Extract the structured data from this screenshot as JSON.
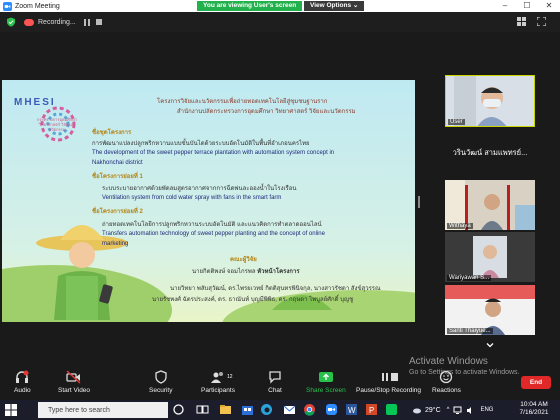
{
  "window": {
    "title": "Zoom Meeting",
    "min": "–",
    "max": "☐",
    "close": "✕"
  },
  "recording": {
    "label": "Recording..."
  },
  "share_banner": {
    "viewing": "You are viewing User's screen",
    "view_options": "View Options ⌄"
  },
  "slide": {
    "logo": "MHESI",
    "logo_sub": "กระทรวงการอุดมศึกษา วิทยาศาสตร์ วิจัยและนวัตกรรม",
    "header1": "โครงการวิจัยและนวัตกรรมเพื่อถ่ายทอดเทคโนโลยีสู่ชุมชนฐานราก",
    "header2": "สำนักงานปลัดกระทรวงการอุดมศึกษา วิทยาศาสตร์ วิจัยและนวัตกรรม",
    "project_label": "ชื่อชุดโครงการ",
    "project_th": "การพัฒนาแปลงปลูกพริกหวานแบบขั้นบันไดด้วยระบบอัตโนมัติในพื้นที่อำเภอนครไทย",
    "project_en1": "The development of the sweet pepper terrace plantation with automation  system concept in",
    "project_en2": "Nakhonchai district",
    "sub1_label": "ชื่อโครงการย่อยที่ 1",
    "sub1_th": "ระบบระบายอากาศด้วยพัดลมสูตรอากาศจากการฉีดพ่นละอองน้ำในโรงเรือน",
    "sub1_en": "Ventilation system  from cold water spray with fans in the smart farm",
    "sub2_label": "ชื่อโครงการย่อยที่ 2",
    "sub2_th": "ถ่ายทอดเทคโนโลยีการปลูกพริกหวานระบบอัตโนมัติ และแนวคิดการทำตลาดออนไลน์",
    "sub2_en1": "Transfers automation technology of sweet pepper planting and the concept of online",
    "sub2_en2": "marketing",
    "team_label": "คณะผู้วิจัย",
    "lead": "นายกิตติพงษ์ จอมไกรพล",
    "lead_role": "หัวหน้าโครงการ",
    "members1": "นายวิทยา พลับสุวัฒน์, ดร.ไพรยเวทย์ กิตติสุนทรพินิจกุล, นางสาวรัชดา สังข์สุวรรณ",
    "members2": "นายรัชพงศ์ ฉัตรประสงค์, ดร. ธาณันท์ บุญมีพิพิธ, ดร. กฤษดา ไพบูลย์ศักดิ์ บุญชู"
  },
  "participants": [
    {
      "name": "User"
    },
    {
      "name": "วรินวัฒน์ สามแพทรย์..."
    },
    {
      "name": "Withaya"
    },
    {
      "name": "Wariyawan S..."
    },
    {
      "name": "Santi Thaiyue..."
    }
  ],
  "watermark": {
    "line1": "Activate Windows",
    "line2": "Go to Settings to activate Windows."
  },
  "toolbar": {
    "audio": "Audio",
    "start_video": "Start Video",
    "security": "Security",
    "participants": "Participants",
    "participants_count": "12",
    "chat": "Chat",
    "share_screen": "Share Screen",
    "pause_recording": "Pause/Stop Recording",
    "reactions": "Reactions",
    "end": "End"
  },
  "taskbar": {
    "search_placeholder": "Type here to search",
    "temperature": "29°C",
    "language": "ENG",
    "time": "10:04 AM",
    "date": "7/16/2021"
  },
  "colors": {
    "zoom_blue": "#2d8cff",
    "share_green": "#22b14c",
    "end_red": "#e02828",
    "speaker_border": "#c9d400"
  }
}
